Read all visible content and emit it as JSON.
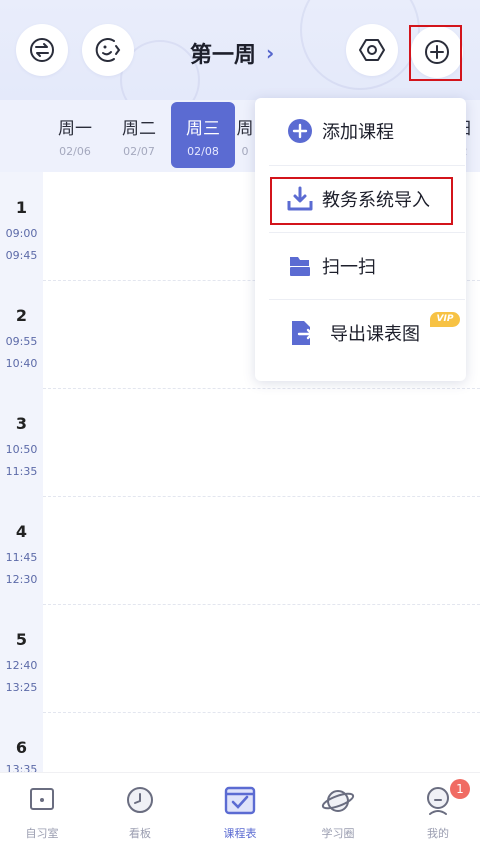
{
  "header": {
    "week_title": "第一周",
    "chevron": "›",
    "left_buttons": [
      {
        "icon": "swap-arrows-icon"
      },
      {
        "icon": "smile-face-icon"
      }
    ],
    "right_buttons": [
      {
        "icon": "hexagon-settings-icon"
      },
      {
        "icon": "add-circle-icon"
      }
    ]
  },
  "days": [
    {
      "name": "周一",
      "date": "02/06",
      "active": false
    },
    {
      "name": "周二",
      "date": "02/07",
      "active": false
    },
    {
      "name": "周三",
      "date": "02/08",
      "active": true
    },
    {
      "name": "周",
      "date": "0",
      "active": false
    },
    {
      "name": "日",
      "date": "2",
      "active": false
    }
  ],
  "periods": [
    {
      "num": "1",
      "start": "09:00",
      "end": "09:45"
    },
    {
      "num": "2",
      "start": "09:55",
      "end": "10:40"
    },
    {
      "num": "3",
      "start": "10:50",
      "end": "11:35"
    },
    {
      "num": "4",
      "start": "11:45",
      "end": "12:30"
    },
    {
      "num": "5",
      "start": "12:40",
      "end": "13:25"
    },
    {
      "num": "6",
      "start": "13:35",
      "end": ""
    }
  ],
  "menu": {
    "items": [
      {
        "label": "添加课程",
        "icon": "plus-circle-icon"
      },
      {
        "label": "教务系统导入",
        "icon": "download-tray-icon"
      },
      {
        "label": "扫一扫",
        "icon": "scan-icon"
      },
      {
        "label": "导出课表图",
        "icon": "export-file-icon"
      }
    ],
    "vip_badge": "VIP"
  },
  "bottom_nav": {
    "items": [
      {
        "label": "自习室",
        "icon": "study-room-icon",
        "active": false
      },
      {
        "label": "看板",
        "icon": "clock-board-icon",
        "active": false
      },
      {
        "label": "课程表",
        "icon": "schedule-icon",
        "active": true
      },
      {
        "label": "学习圈",
        "icon": "planet-icon",
        "active": false
      },
      {
        "label": "我的",
        "icon": "profile-icon",
        "active": false
      }
    ],
    "profile_badge": "1"
  },
  "colors": {
    "accent": "#5b6bd2",
    "highlight_red": "#d3141b",
    "badge_red": "#f06b63",
    "vip_yellow": "#f7c244"
  }
}
